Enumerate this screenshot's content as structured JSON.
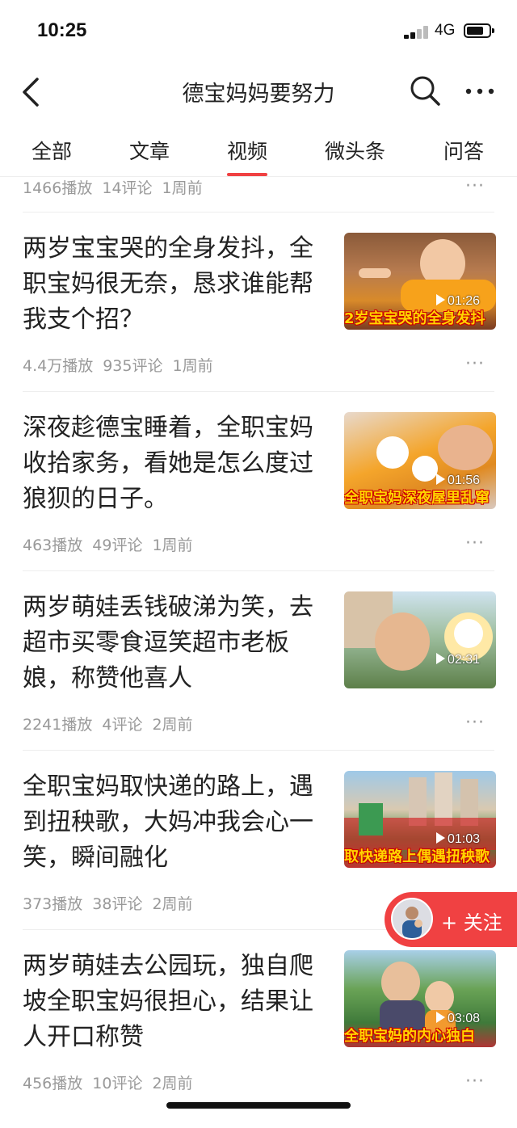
{
  "status_bar": {
    "time": "10:25",
    "network": "4G"
  },
  "nav": {
    "title": "德宝妈妈要努力"
  },
  "tabs": [
    {
      "label": "全部",
      "active": false
    },
    {
      "label": "文章",
      "active": false
    },
    {
      "label": "视频",
      "active": true
    },
    {
      "label": "微头条",
      "active": false
    },
    {
      "label": "问答",
      "active": false
    }
  ],
  "top_meta": {
    "plays": "1466播放",
    "comments": "14评论",
    "time": "1周前"
  },
  "items": [
    {
      "title": "两岁宝宝哭的全身发抖，全职宝妈很无奈，恳求谁能帮我支个招？",
      "plays": "4.4万播放",
      "comments": "935评论",
      "time": "1周前",
      "duration": "01:26",
      "caption": "2岁宝宝哭的全身发抖"
    },
    {
      "title": "深夜趁德宝睡着，全职宝妈收拾家务，看她是怎么度过狼狈的日子。",
      "plays": "463播放",
      "comments": "49评论",
      "time": "1周前",
      "duration": "01:56",
      "caption": "全职宝妈深夜屋里乱窜"
    },
    {
      "title": "两岁萌娃丢钱破涕为笑，去超市买零食逗笑超市老板娘，称赞他喜人",
      "plays": "2241播放",
      "comments": "4评论",
      "time": "2周前",
      "duration": "02:31",
      "caption": ""
    },
    {
      "title": "全职宝妈取快递的路上，遇到扭秧歌，大妈冲我会心一笑，瞬间融化",
      "plays": "373播放",
      "comments": "38评论",
      "time": "2周前",
      "duration": "01:03",
      "caption": "取快递路上偶遇扭秧歌"
    },
    {
      "title": "两岁萌娃去公园玩，独自爬坡全职宝妈很担心，结果让人开口称赞",
      "plays": "456播放",
      "comments": "10评论",
      "time": "2周前",
      "duration": "03:08",
      "caption": "全职宝妈的内心独白"
    }
  ],
  "follow": {
    "label": "+ 关注"
  },
  "colors": {
    "accent": "#f04142",
    "meta_text": "#999999",
    "title_text": "#222222"
  }
}
